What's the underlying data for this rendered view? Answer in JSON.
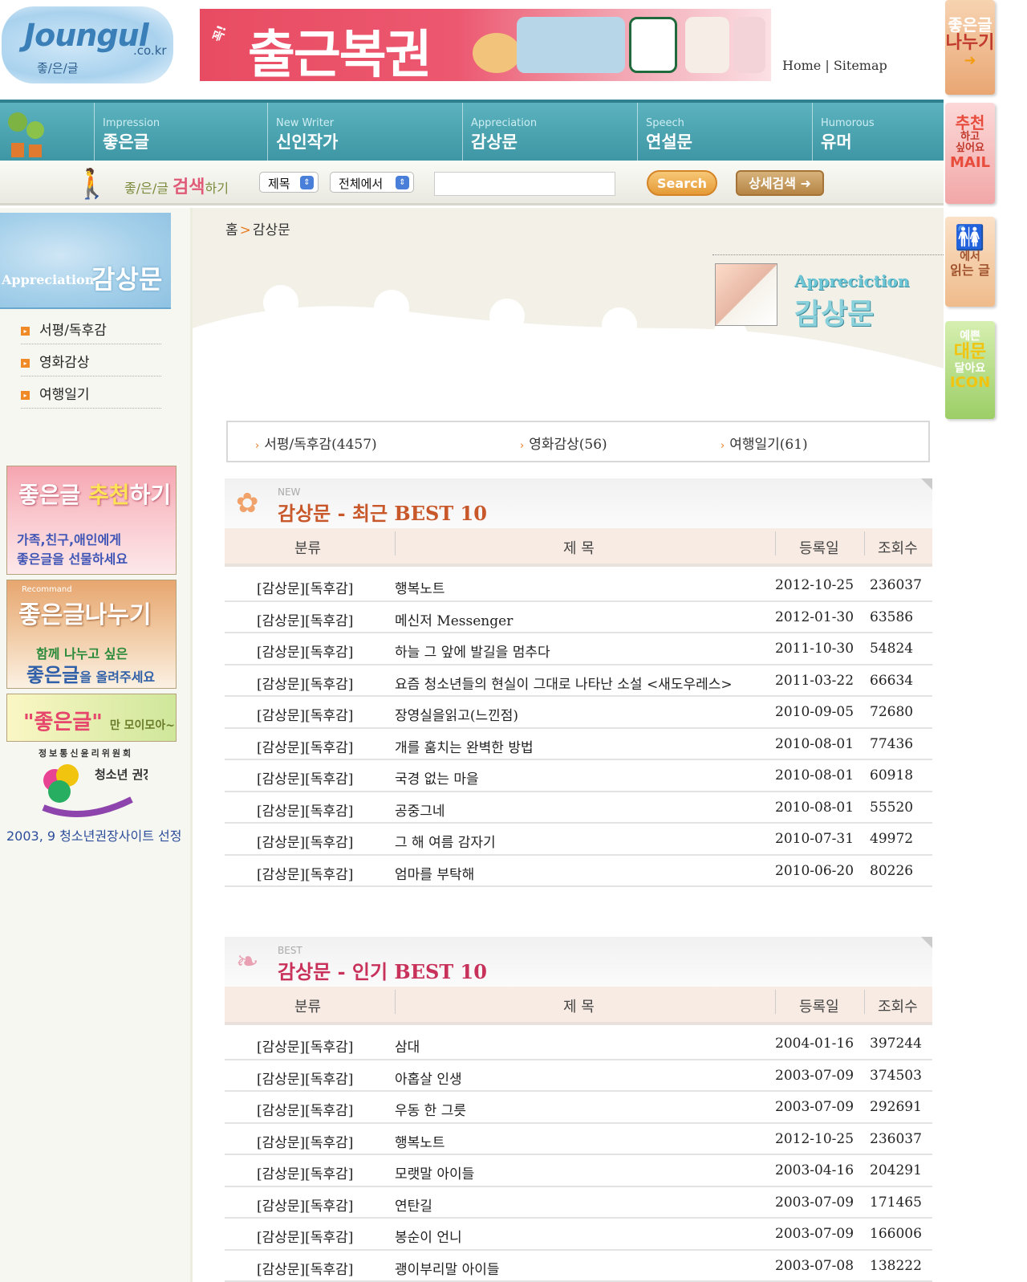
{
  "header": {
    "logo_brand": "Joungul",
    "logo_domain": ".co.kr",
    "logo_kor": "좋/은/글",
    "banner_badge": "꼭!",
    "banner_title": "출근복권",
    "banner_products": [
      "Dunkin Donuts",
      "earbuds",
      "Starbucks coffee",
      "gift set",
      "ice cream"
    ],
    "home_link": "Home",
    "sitemap_link": "Sitemap",
    "nav_divider": "|"
  },
  "gnb": {
    "items": [
      {
        "en": "Impression",
        "ko": "좋은글"
      },
      {
        "en": "New Writer",
        "ko": "신인작가"
      },
      {
        "en": "Appreciation",
        "ko": "감상문"
      },
      {
        "en": "Speech",
        "ko": "연설문"
      },
      {
        "en": "Humorous",
        "ko": "유머"
      }
    ]
  },
  "search": {
    "label_small": "좋/은/글",
    "label_big": "검색",
    "label_tail": "하기",
    "field_select": "제목",
    "scope_select": "전체에서",
    "query": "",
    "search_button": "Search",
    "detail_button": "상세검색"
  },
  "right_tabs": {
    "share": [
      "좋은글",
      "나누기"
    ],
    "mail": [
      "추천",
      "하고",
      "싶어요",
      "MAIL"
    ],
    "toilet": [
      "에서",
      "읽는 글"
    ],
    "icon": [
      "예쁜",
      "대문",
      "달아요",
      "ICON"
    ]
  },
  "left": {
    "title_en": "Appreciation",
    "title_ko": "감상문",
    "nav": [
      "서평/독후감",
      "영화감상",
      "여행일기"
    ],
    "box1": {
      "h1": "좋은글",
      "h2": "추천",
      "h3": "하기",
      "s1": "가족,친구,애인에게",
      "s2": "좋은글을 선물하세요"
    },
    "box2": {
      "rec": "Recommand",
      "h": "좋은글나누기",
      "s1": "함께 나누고 싶은",
      "s2": "좋은글",
      "s2_tail": "을 올려주세요"
    },
    "box3": {
      "h": "\"좋은글\"",
      "tail": "만 모이모아~"
    },
    "org": "정보통신윤리위원회",
    "mark": "청소년 권장사이트",
    "caption": "2003, 9 청소년권장사이트 선정"
  },
  "main": {
    "breadcrumb_home": "홈",
    "breadcrumb_sep": ">",
    "breadcrumb_current": "감상문",
    "head_en": "Appreciction",
    "head_ko": "감상문",
    "categories": [
      "서평/독후감(4457)",
      "영화감상(56)",
      "여행일기(61)"
    ],
    "recent": {
      "tag": "NEW",
      "title": "감상문 - 최근 BEST 10",
      "columns": [
        "분류",
        "제 목",
        "등록일",
        "조회수"
      ],
      "rows": [
        {
          "cat": "[감상문][독후감]",
          "title": "행복노트",
          "date": "2012-10-25",
          "views": "236037"
        },
        {
          "cat": "[감상문][독후감]",
          "title": "메신저 Messenger",
          "date": "2012-01-30",
          "views": "63586"
        },
        {
          "cat": "[감상문][독후감]",
          "title": "하늘 그 앞에 발길을 멈추다",
          "date": "2011-10-30",
          "views": "54824"
        },
        {
          "cat": "[감상문][독후감]",
          "title": "요즘 청소년들의 현실이 그대로 나타난 소설 <새도우레스>",
          "date": "2011-03-22",
          "views": "66634"
        },
        {
          "cat": "[감상문][독후감]",
          "title": "장영실을읽고(느낀점)",
          "date": "2010-09-05",
          "views": "72680"
        },
        {
          "cat": "[감상문][독후감]",
          "title": "개를 훔치는 완벽한 방법",
          "date": "2010-08-01",
          "views": "77436"
        },
        {
          "cat": "[감상문][독후감]",
          "title": "국경 없는 마을",
          "date": "2010-08-01",
          "views": "60918"
        },
        {
          "cat": "[감상문][독후감]",
          "title": "공중그네",
          "date": "2010-08-01",
          "views": "55520"
        },
        {
          "cat": "[감상문][독후감]",
          "title": "그 해 여름 감자기",
          "date": "2010-07-31",
          "views": "49972"
        },
        {
          "cat": "[감상문][독후감]",
          "title": "엄마를 부탁해",
          "date": "2010-06-20",
          "views": "80226"
        }
      ]
    },
    "popular": {
      "tag": "BEST",
      "title": "감상문 - 인기 BEST 10",
      "columns": [
        "분류",
        "제 목",
        "등록일",
        "조회수"
      ],
      "rows": [
        {
          "cat": "[감상문][독후감]",
          "title": "삼대",
          "date": "2004-01-16",
          "views": "397244"
        },
        {
          "cat": "[감상문][독후감]",
          "title": "아홉살 인생",
          "date": "2003-07-09",
          "views": "374503"
        },
        {
          "cat": "[감상문][독후감]",
          "title": "우동 한 그릇",
          "date": "2003-07-09",
          "views": "292691"
        },
        {
          "cat": "[감상문][독후감]",
          "title": "행복노트",
          "date": "2012-10-25",
          "views": "236037"
        },
        {
          "cat": "[감상문][독후감]",
          "title": "모랫말 아이들",
          "date": "2003-04-16",
          "views": "204291"
        },
        {
          "cat": "[감상문][독후감]",
          "title": "연탄길",
          "date": "2003-07-09",
          "views": "171465"
        },
        {
          "cat": "[감상문][독후감]",
          "title": "봉순이 언니",
          "date": "2003-07-09",
          "views": "166006"
        },
        {
          "cat": "[감상문][독후감]",
          "title": "괭이부리말 아이들",
          "date": "2003-07-08",
          "views": "138222"
        }
      ]
    }
  },
  "colors": {
    "gnb_bg": "#4aa6b3",
    "recent_title": "#c8572a",
    "popular_title": "#c8315a",
    "accent_orange": "#e77a1f"
  }
}
